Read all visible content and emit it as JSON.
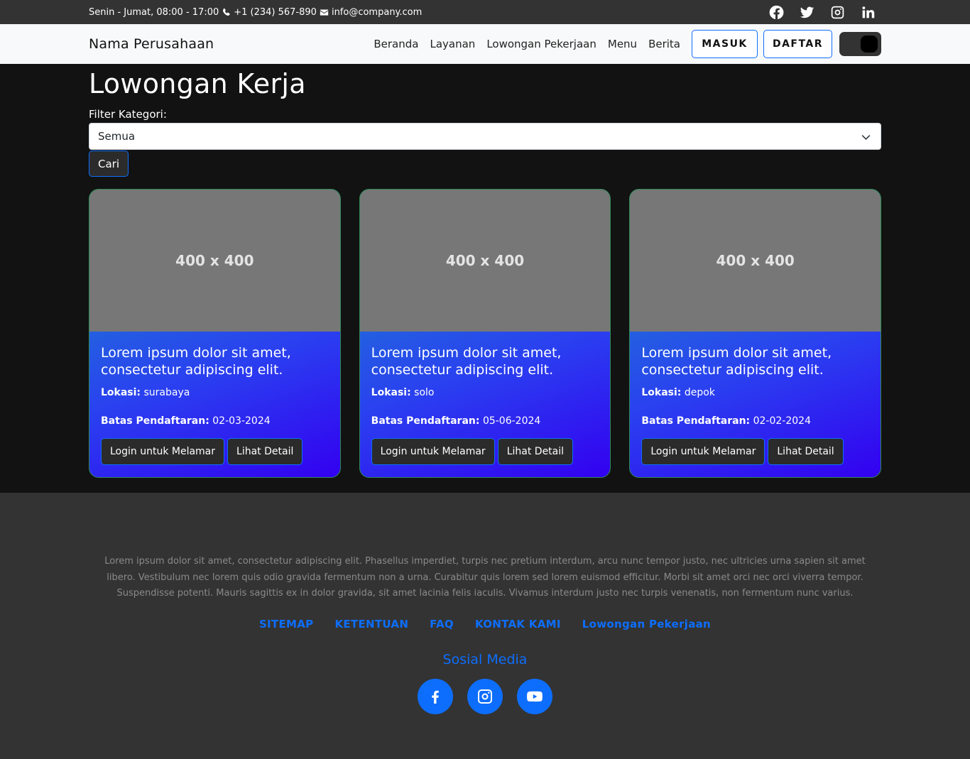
{
  "topbar": {
    "hours": "Senin - Jumat, 08:00 - 17:00",
    "phone": "+1 (234) 567-890",
    "email": "info@company.com",
    "social_icons": [
      "facebook-icon",
      "twitter-icon",
      "instagram-icon",
      "linkedin-icon"
    ]
  },
  "navbar": {
    "brand": "Nama Perusahaan",
    "links": [
      "Beranda",
      "Layanan",
      "Lowongan Pekerjaan",
      "Menu",
      "Berita"
    ],
    "login_label": "MASUK",
    "register_label": "DAFTAR"
  },
  "main": {
    "title": "Lowongan Kerja",
    "filter_label": "Filter Kategori:",
    "filter_selected": "Semua",
    "search_label": "Cari",
    "cards": [
      {
        "image_label": "400 x 400",
        "title": "Lorem ipsum dolor sit amet, consectetur adipiscing elit.",
        "location_label": "Lokasi:",
        "location": "surabaya",
        "deadline_label": "Batas Pendaftaran:",
        "deadline": "02-03-2024",
        "apply_label": "Login untuk Melamar",
        "detail_label": "Lihat Detail"
      },
      {
        "image_label": "400 x 400",
        "title": "Lorem ipsum dolor sit amet, consectetur adipiscing elit.",
        "location_label": "Lokasi:",
        "location": "solo",
        "deadline_label": "Batas Pendaftaran:",
        "deadline": "05-06-2024",
        "apply_label": "Login untuk Melamar",
        "detail_label": "Lihat Detail"
      },
      {
        "image_label": "400 x 400",
        "title": "Lorem ipsum dolor sit amet, consectetur adipiscing elit.",
        "location_label": "Lokasi:",
        "location": "depok",
        "deadline_label": "Batas Pendaftaran:",
        "deadline": "02-02-2024",
        "apply_label": "Login untuk Melamar",
        "detail_label": "Lihat Detail"
      }
    ]
  },
  "footer": {
    "text": "Lorem ipsum dolor sit amet, consectetur adipiscing elit. Phasellus imperdiet, turpis nec pretium interdum, arcu nunc tempor justo, nec ultricies urna sapien sit amet libero. Vestibulum nec lorem quis odio gravida fermentum non a urna. Curabitur quis lorem sed lorem euismod efficitur. Morbi sit amet orci nec orci viverra tempor. Suspendisse potenti. Mauris sagittis ex in dolor gravida, sit amet lacinia felis iaculis. Vivamus interdum justo nec turpis venenatis, non fermentum nunc varius.",
    "links": [
      "SITEMAP",
      "KETENTUAN",
      "FAQ",
      "KONTAK KAMI",
      "Lowongan Pekerjaan"
    ],
    "social_title": "Sosial Media",
    "social_icons": [
      "facebook-icon",
      "instagram-icon",
      "youtube-icon"
    ]
  },
  "colors": {
    "accent": "#0d6efd",
    "topbar_bg": "#333333",
    "page_bg": "#121212",
    "card_gradient_start": "#1aa6b0",
    "card_gradient_end": "#3300f0"
  }
}
